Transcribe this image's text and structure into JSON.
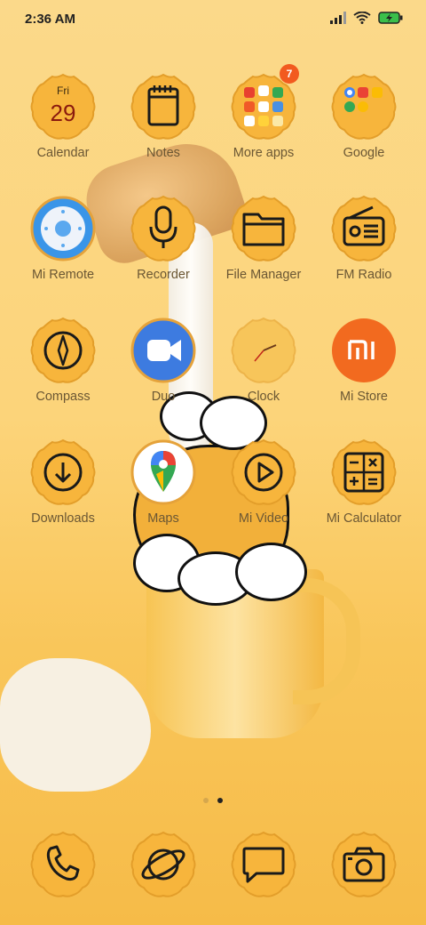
{
  "status": {
    "time": "2:36 AM",
    "icons": [
      "signal-icon",
      "wifi-icon",
      "battery-charging-icon"
    ]
  },
  "calendar_icon": {
    "day": "Fri",
    "date": "29"
  },
  "rows": [
    [
      {
        "name": "Calendar",
        "icon": "calendar-icon"
      },
      {
        "name": "Notes",
        "icon": "notes-icon"
      },
      {
        "name": "More apps",
        "icon": "folder-more-apps-icon",
        "badge": "7"
      },
      {
        "name": "Google",
        "icon": "folder-google-icon"
      }
    ],
    [
      {
        "name": "Mi Remote",
        "icon": "mi-remote-icon"
      },
      {
        "name": "Recorder",
        "icon": "microphone-icon"
      },
      {
        "name": "File Manager",
        "icon": "folder-icon"
      },
      {
        "name": "FM Radio",
        "icon": "radio-icon"
      }
    ],
    [
      {
        "name": "Compass",
        "icon": "compass-icon"
      },
      {
        "name": "Duo",
        "icon": "duo-video-icon"
      },
      {
        "name": "Clock",
        "icon": "clock-icon"
      },
      {
        "name": "Mi Store",
        "icon": "mi-store-icon"
      }
    ],
    [
      {
        "name": "Downloads",
        "icon": "download-icon"
      },
      {
        "name": "Maps",
        "icon": "maps-pin-icon"
      },
      {
        "name": "Mi Video",
        "icon": "play-icon"
      },
      {
        "name": "Mi Calculator",
        "icon": "calculator-icon"
      }
    ]
  ],
  "dock": [
    {
      "icon": "phone-icon"
    },
    {
      "icon": "browser-planet-icon"
    },
    {
      "icon": "messages-icon"
    },
    {
      "icon": "camera-icon"
    }
  ],
  "pages": {
    "count": 2,
    "active": 2
  },
  "colors": {
    "tile": "#f7b53c",
    "tile_border": "#e39e2a",
    "line": "#1a1a1a",
    "mi_orange": "#f26a1f",
    "duo_blue": "#3d7be0"
  }
}
